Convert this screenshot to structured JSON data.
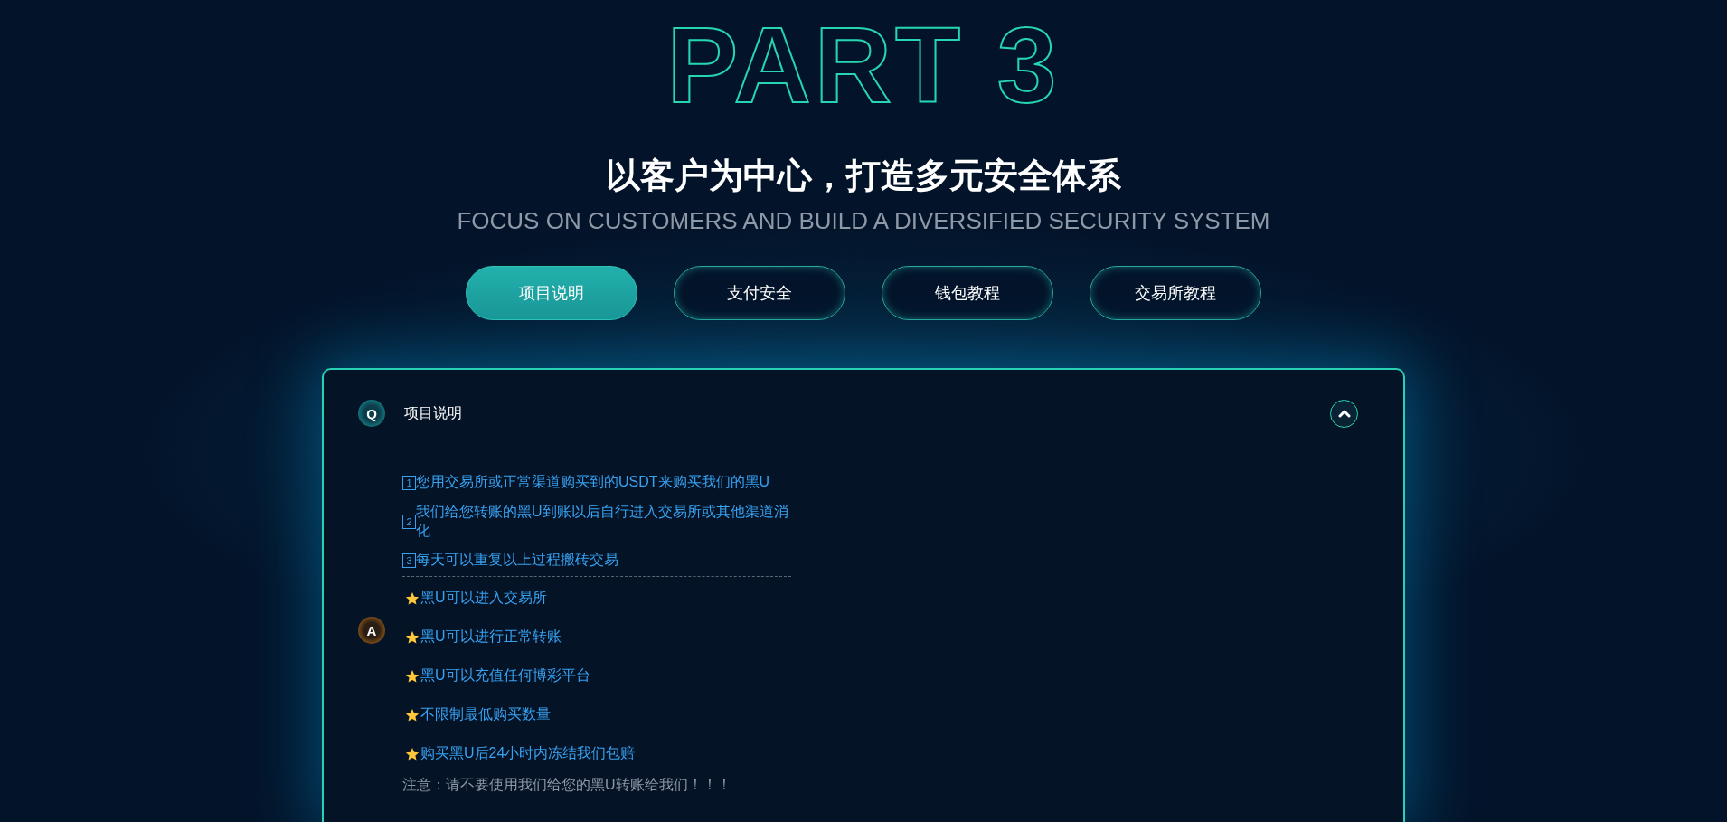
{
  "hero": {
    "title": "PART 3",
    "heading": "以客户为中心，打造多元安全体系",
    "subtitle": "FOCUS ON CUSTOMERS AND BUILD A DIVERSIFIED SECURITY SYSTEM"
  },
  "tabs": [
    {
      "label": "项目说明",
      "selected": true
    },
    {
      "label": "支付安全",
      "selected": false
    },
    {
      "label": "钱包教程",
      "selected": false
    },
    {
      "label": "交易所教程",
      "selected": false
    }
  ],
  "faq": {
    "question_badge": "Q",
    "question": "项目说明",
    "expanded": true,
    "answer_badge": "A",
    "answer": [
      {
        "kind": "numbered",
        "number": "1",
        "text": "您用交易所或正常渠道购买到的USDT来购买我们的黑U"
      },
      {
        "kind": "numbered",
        "number": "2",
        "text": "我们给您转账的黑U到账以后自行进入交易所或其他渠道消化"
      },
      {
        "kind": "numbered",
        "number": "3",
        "text": "每天可以重复以上过程搬砖交易"
      },
      {
        "kind": "divider"
      },
      {
        "kind": "starred",
        "text": "黑U可以进入交易所"
      },
      {
        "kind": "starred",
        "text": "黑U可以进行正常转账"
      },
      {
        "kind": "starred",
        "text": "黑U可以充值任何博彩平台"
      },
      {
        "kind": "starred",
        "text": "不限制最低购买数量"
      },
      {
        "kind": "starred",
        "text": "购买黑U后24小时内冻结我们包赔"
      },
      {
        "kind": "divider"
      },
      {
        "kind": "note",
        "text": "注意：请不要使用我们给您的黑U转账给我们！！！"
      }
    ]
  }
}
